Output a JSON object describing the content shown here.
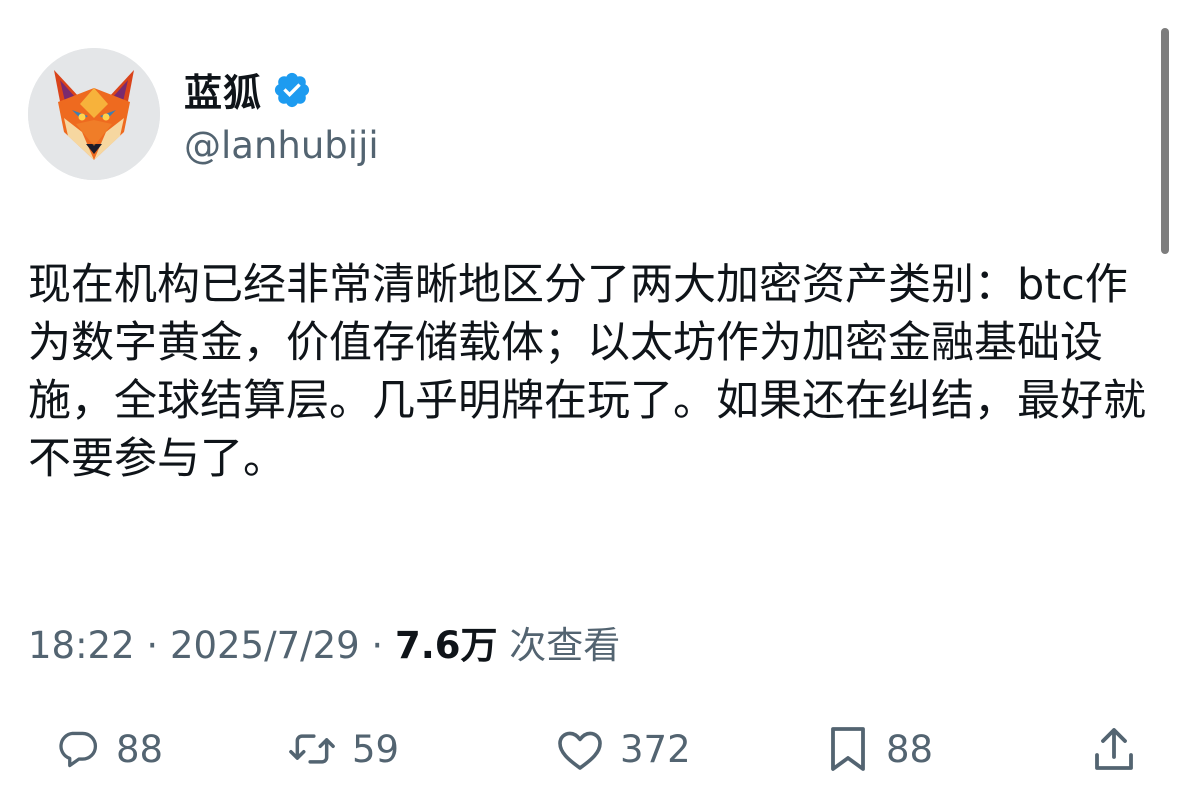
{
  "author": {
    "display_name": "蓝狐",
    "handle": "@lanhubiji",
    "verified": true,
    "avatar_icon": "fox-avatar-icon",
    "verified_icon": "verified-badge-icon"
  },
  "tweet": {
    "text": "现在机构已经非常清晰地区分了两大加密资产类别：btc作为数字黄金，价值存储载体；以太坊作为加密金融基础设施，全球结算层。几乎明牌在玩了。如果还在纠结，最好就不要参与了。"
  },
  "meta": {
    "time": "18:22",
    "separator": " · ",
    "date": "2025/7/29",
    "views_count": "7.6万",
    "views_label": " 次查看"
  },
  "actions": {
    "reply": {
      "icon": "reply-icon",
      "count": "88"
    },
    "retweet": {
      "icon": "retweet-icon",
      "count": "59"
    },
    "like": {
      "icon": "heart-icon",
      "count": "372"
    },
    "bookmark": {
      "icon": "bookmark-icon",
      "count": "88"
    },
    "share": {
      "icon": "share-icon"
    }
  },
  "colors": {
    "text_primary": "#0f1419",
    "text_secondary": "#536471",
    "verified_blue": "#1d9bf0",
    "fox_orange": "#e8541e"
  }
}
